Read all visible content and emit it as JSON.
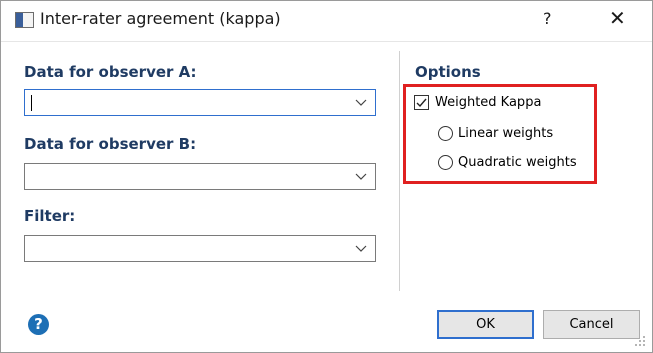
{
  "window": {
    "title": "Inter-rater agreement (kappa)",
    "help_glyph": "?",
    "close_glyph": "✕"
  },
  "form": {
    "observer_a_label": "Data for observer A:",
    "observer_a_value": "",
    "observer_b_label": "Data for observer B:",
    "observer_b_value": "",
    "filter_label": "Filter:",
    "filter_value": ""
  },
  "options": {
    "title": "Options",
    "weighted_kappa_label": "Weighted Kappa",
    "weighted_kappa_checked": true,
    "linear_label": "Linear weights",
    "linear_selected": false,
    "quadratic_label": "Quadratic weights",
    "quadratic_selected": false
  },
  "footer": {
    "help_icon_text": "?",
    "ok_label": "OK",
    "cancel_label": "Cancel"
  },
  "colors": {
    "label_blue": "#1f3b63",
    "highlight_red": "#e02020",
    "focus_blue": "#2f6fce",
    "help_blue": "#1d6fb5"
  }
}
